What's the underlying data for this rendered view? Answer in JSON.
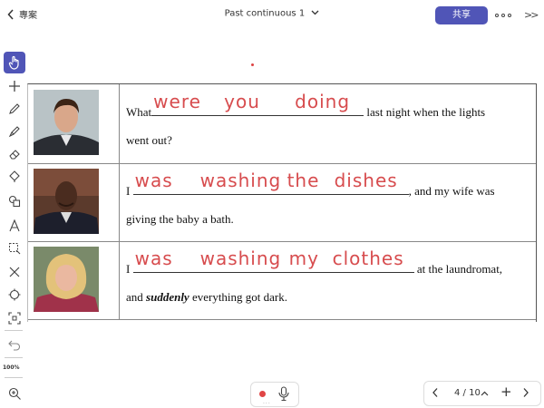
{
  "header": {
    "back_label": "專案",
    "doc_title": "Past continuous 1",
    "share_label": "共享"
  },
  "toolbar": {
    "zoom": "100%"
  },
  "worksheet": {
    "rows": [
      {
        "before": "What",
        "answers": [
          "were",
          "you",
          "doing"
        ],
        "after_line1": "last night when the lights",
        "line2": "went out?"
      },
      {
        "before": "I",
        "answers": [
          "was",
          "washing",
          "the",
          "dishes"
        ],
        "after_line1": ", and my wife was",
        "line2": "giving the baby a bath."
      },
      {
        "before": "I",
        "answers": [
          "was",
          "washing",
          "my",
          "clothes"
        ],
        "after_line1": "at the laundromat,",
        "line2_pre": "and",
        "line2_em": "suddenly",
        "line2_post": "everything got dark."
      }
    ]
  },
  "footer": {
    "page_indicator": "4 / 10"
  },
  "colors": {
    "accent": "#5055b7",
    "ink": "#d74c4e",
    "record": "#e04545"
  }
}
